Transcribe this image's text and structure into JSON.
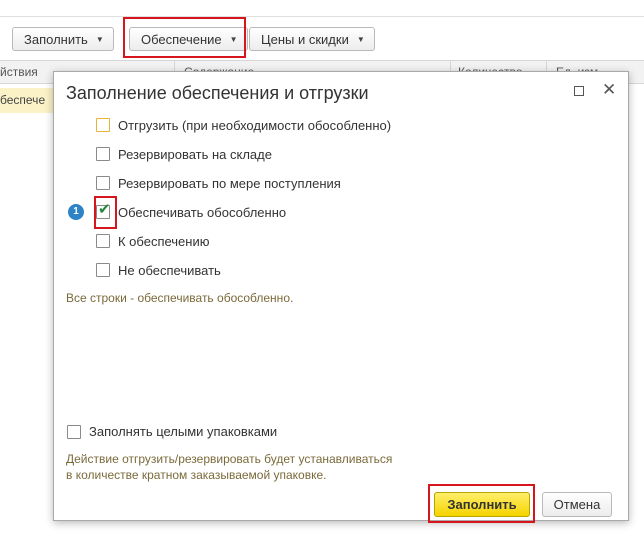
{
  "toolbar": {
    "fill_label": "Заполнить",
    "provision_label": "Обеспечение",
    "prices_label": "Цены и скидки"
  },
  "grid": {
    "col_actions": "йствия",
    "col_content": "Содержание",
    "col_quantity": "Количество",
    "col_unit": "Ед. изм.",
    "row_text": "беспече"
  },
  "dialog": {
    "title": "Заполнение обеспечения и отгрузки",
    "options": [
      {
        "label": "Отгрузить (при необходимости обособленно)",
        "checked": false
      },
      {
        "label": "Резервировать на складе",
        "checked": false
      },
      {
        "label": "Резервировать по мере поступления",
        "checked": false
      },
      {
        "label": "Обеспечивать обособленно",
        "checked": true
      },
      {
        "label": "К обеспечению",
        "checked": false
      },
      {
        "label": "Не обеспечивать",
        "checked": false
      }
    ],
    "step_badge": "1",
    "hint": "Все строки - обеспечивать обособленно.",
    "pack_label": "Заполнять целыми упаковками",
    "pack_checked": false,
    "pack_note_line1": "Действие отгрузить/резервировать будет устанавливаться",
    "pack_note_line2": "в количестве кратном заказываемой упаковке.",
    "fill_button": "Заполнить",
    "cancel_button": "Отмена"
  },
  "colors": {
    "highlight": "#d7151c",
    "primary_button": "#f5d300",
    "checkmark": "#1f8a3f",
    "info_badge": "#2e83c6"
  }
}
